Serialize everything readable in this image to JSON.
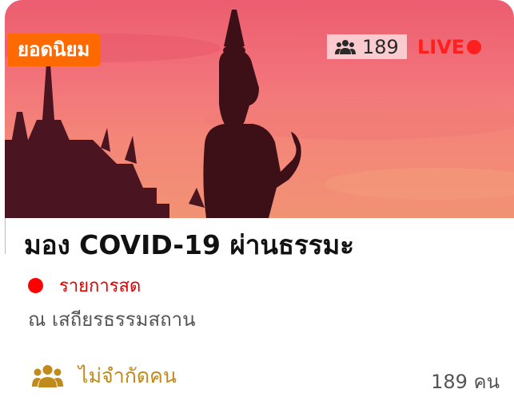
{
  "hero": {
    "badge": "ยอดนิยม",
    "viewer_count": "189",
    "live_label": "LIVE",
    "colors": {
      "sky_top": "#ec5d6f",
      "sky_bottom": "#f19274",
      "badge": "#ff6a00",
      "live": "#ff1f1f"
    }
  },
  "event": {
    "title": "มอง COVID-19 ผ่านธรรมะ",
    "status": "รายการสด",
    "venue": "ณ เสถียรธรรมสถาน",
    "capacity_label": "ไม่จำกัดคน",
    "attendees": "189 คน"
  },
  "icons": {
    "viewers": "users-group-icon",
    "capacity": "users-group-icon",
    "status": "red-dot-icon"
  }
}
